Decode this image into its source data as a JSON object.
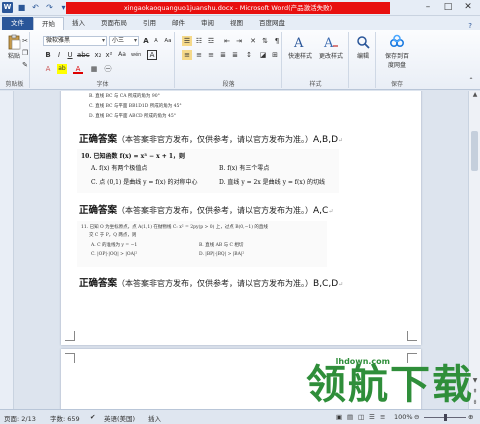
{
  "window": {
    "title": "xingaokaoquanguo1juanshu.docx - Microsoft Word(产品激活失败)",
    "qat_icons": [
      "word-icon",
      "save-icon",
      "undo-icon",
      "redo-icon"
    ],
    "controls": [
      "minimize",
      "maximize",
      "close"
    ]
  },
  "tabs": [
    "文件",
    "开始",
    "插入",
    "页面布局",
    "引用",
    "邮件",
    "审阅",
    "视图",
    "百度网盘"
  ],
  "active_tab": "开始",
  "ribbon": {
    "clipboard": {
      "paste_label": "粘贴",
      "group_label": "剪贴板"
    },
    "font": {
      "font_name": "微软雅黑",
      "font_size": "小三",
      "group_label": "字体",
      "bold": "B",
      "italic": "I",
      "underline": "U",
      "text_effect": "A",
      "highlight": "ab",
      "font_color": "A",
      "grow": "A",
      "shrink": "A",
      "clear": "Aa",
      "change_case": "Aa",
      "phonetic": "wén",
      "border": "A"
    },
    "paragraph": {
      "group_label": "段落"
    },
    "styles": {
      "quick_styles_label": "快速样式",
      "change_styles_label": "更改样式",
      "group_label": "样式"
    },
    "editing": {
      "label": "编辑"
    },
    "save_netdisk": {
      "label_line1": "保存到百",
      "label_line2": "度网盘",
      "group_label": "保存"
    }
  },
  "document": {
    "top_lines": [
      "B.  直线 BC 与 CA 所成的角为 90°",
      "C.  直线 BC 与平面 BB1D1D 所成的角为 45°",
      "D.  直线 BC 与平面 ABCD 所成的角为 45°"
    ],
    "answer_prefix": "正确答案",
    "answer_note": "（本答案非官方发布，仅供参考，请以官方发布为准。）",
    "answer1": "A,B,D",
    "q10": {
      "stem": "10.  已知函数 f(x) = x³ − x + 1，则",
      "a": "A.  f(x) 有两个极值点",
      "b": "B.  f(x) 有三个零点",
      "c": "C.  点 (0,1) 是曲线 y = f(x) 的对称中心",
      "d": "D.  直线 y = 2x 是曲线 y = f(x) 的切线"
    },
    "answer2": "A,C",
    "q11": {
      "stem": "11.  已知 O 为坐标原点，点 A(1,1) 在抛物线 C: x² = 2py(p > 0) 上，过点 B(0,−1) 的直线",
      "stem2": "交 C 于 P，Q 两点，则",
      "a": "A.  C 的准线为 y = −1",
      "b": "B.  直线 AB 与 C 相切",
      "c": "C.  |OP|·|OQ| > |OA|²",
      "d": "D.  |BP|·|BQ| > |BA|²"
    },
    "answer3": "B,C,D",
    "para_mark": "↵"
  },
  "watermark": {
    "text": "领航下载",
    "url": "lhdown.com"
  },
  "statusbar": {
    "page": "页面: 2/13",
    "words": "字数: 659",
    "language": "英语(美国)",
    "mode": "插入",
    "zoom": "100%",
    "zoom_level": 1.0
  }
}
